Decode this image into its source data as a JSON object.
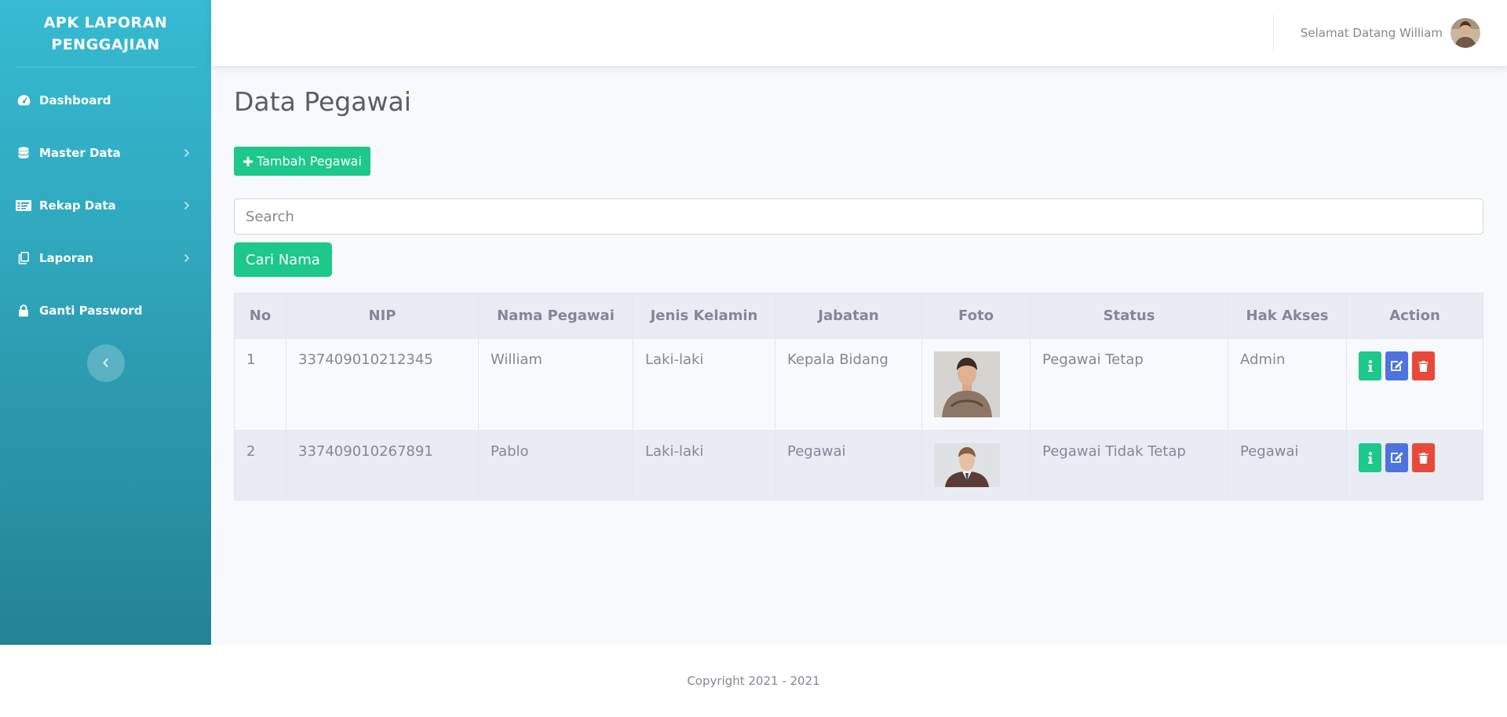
{
  "sidebar": {
    "brand": "APK LAPORAN PENGGAJIAN",
    "items": [
      {
        "label": "Dashboard",
        "icon": "tachometer-icon",
        "has_arrow": false
      },
      {
        "label": "Master Data",
        "icon": "database-icon",
        "has_arrow": true
      },
      {
        "label": "Rekap Data",
        "icon": "list-card-icon",
        "has_arrow": true
      },
      {
        "label": "Laporan",
        "icon": "copy-icon",
        "has_arrow": true
      },
      {
        "label": "Ganti Password",
        "icon": "lock-icon",
        "has_arrow": false
      }
    ],
    "toggle_icon": "chevron-left-icon"
  },
  "topbar": {
    "greeting": "Selamat Datang William",
    "avatar_icon": "user-avatar"
  },
  "main": {
    "title": "Data Pegawai",
    "add_button": "Tambah Pegawai",
    "search_placeholder": "Search",
    "search_button": "Cari Nama",
    "table": {
      "headers": [
        "No",
        "NIP",
        "Nama Pegawai",
        "Jenis Kelamin",
        "Jabatan",
        "Foto",
        "Status",
        "Hak Akses",
        "Action"
      ],
      "rows": [
        {
          "no": "1",
          "nip": "337409010212345",
          "nama": "William",
          "jk": "Laki-laki",
          "jabatan": "Kepala Bidang",
          "foto": "photo-william",
          "status": "Pegawai Tetap",
          "hak": "Admin"
        },
        {
          "no": "2",
          "nip": "337409010267891",
          "nama": "Pablo",
          "jk": "Laki-laki",
          "jabatan": "Pegawai",
          "foto": "photo-pablo",
          "status": "Pegawai Tidak Tetap",
          "hak": "Pegawai"
        }
      ],
      "actions": [
        "info-icon",
        "edit-icon",
        "trash-icon"
      ]
    }
  },
  "footer": {
    "copyright": "Copyright 2021 - 2021"
  },
  "colors": {
    "sidebar_top": "#36bbd2",
    "sidebar_bottom": "#248393",
    "success": "#1cc88a",
    "primary": "#4e73df",
    "danger": "#e74a3b"
  }
}
